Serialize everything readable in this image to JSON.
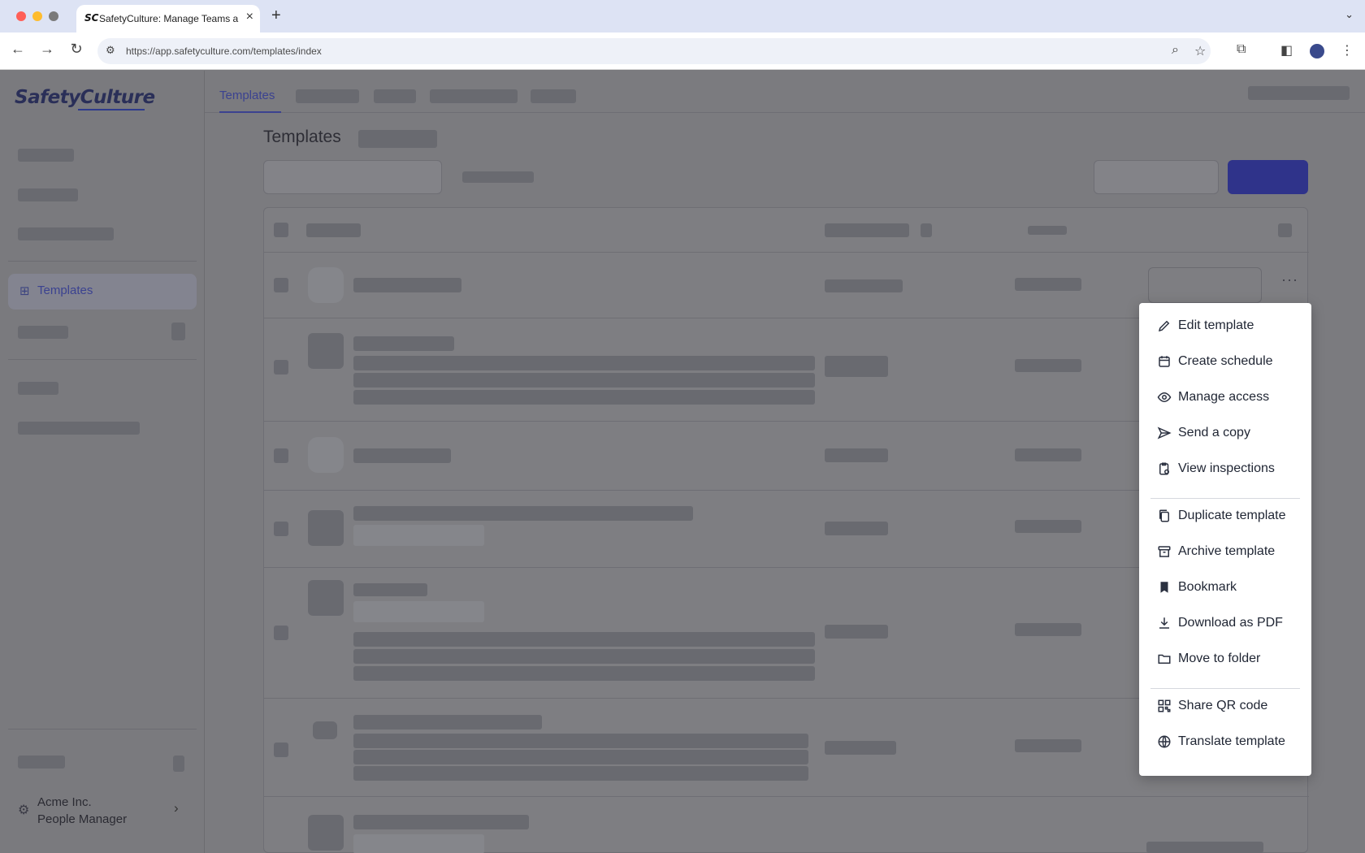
{
  "browser": {
    "tab_title": "SafetyCulture: Manage Teams and...",
    "tab_favicon": "SC",
    "new_tab_symbol": "+",
    "url": "https://app.safetyculture.com/templates/index"
  },
  "app": {
    "logo": "SafetyCulture",
    "sidebar": {
      "active_item_label": "Templates",
      "org": {
        "name": "Acme Inc.",
        "role": "People Manager"
      }
    },
    "topnav": {
      "active_tab": "Templates"
    },
    "page_title": "Templates",
    "row_more_symbol": "···"
  },
  "context_menu": {
    "items": [
      {
        "label": "Edit template",
        "icon": "pencil-icon"
      },
      {
        "label": "Create schedule",
        "icon": "calendar-icon"
      },
      {
        "label": "Manage access",
        "icon": "eye-icon"
      },
      {
        "label": "Send a copy",
        "icon": "send-icon"
      },
      {
        "label": "View inspections",
        "icon": "clipboard-check-icon"
      },
      {
        "label": "Duplicate template",
        "icon": "copy-icon"
      },
      {
        "label": "Archive template",
        "icon": "archive-icon"
      },
      {
        "label": "Bookmark",
        "icon": "bookmark-icon"
      },
      {
        "label": "Download as PDF",
        "icon": "download-icon"
      },
      {
        "label": "Move to folder",
        "icon": "folder-icon"
      },
      {
        "label": "Share QR code",
        "icon": "qr-code-icon"
      },
      {
        "label": "Translate template",
        "icon": "globe-icon"
      }
    ]
  },
  "colors": {
    "accent": "#3b4290",
    "primary_button": "#2f338a",
    "overlay_bg": "#7b7b7f"
  }
}
